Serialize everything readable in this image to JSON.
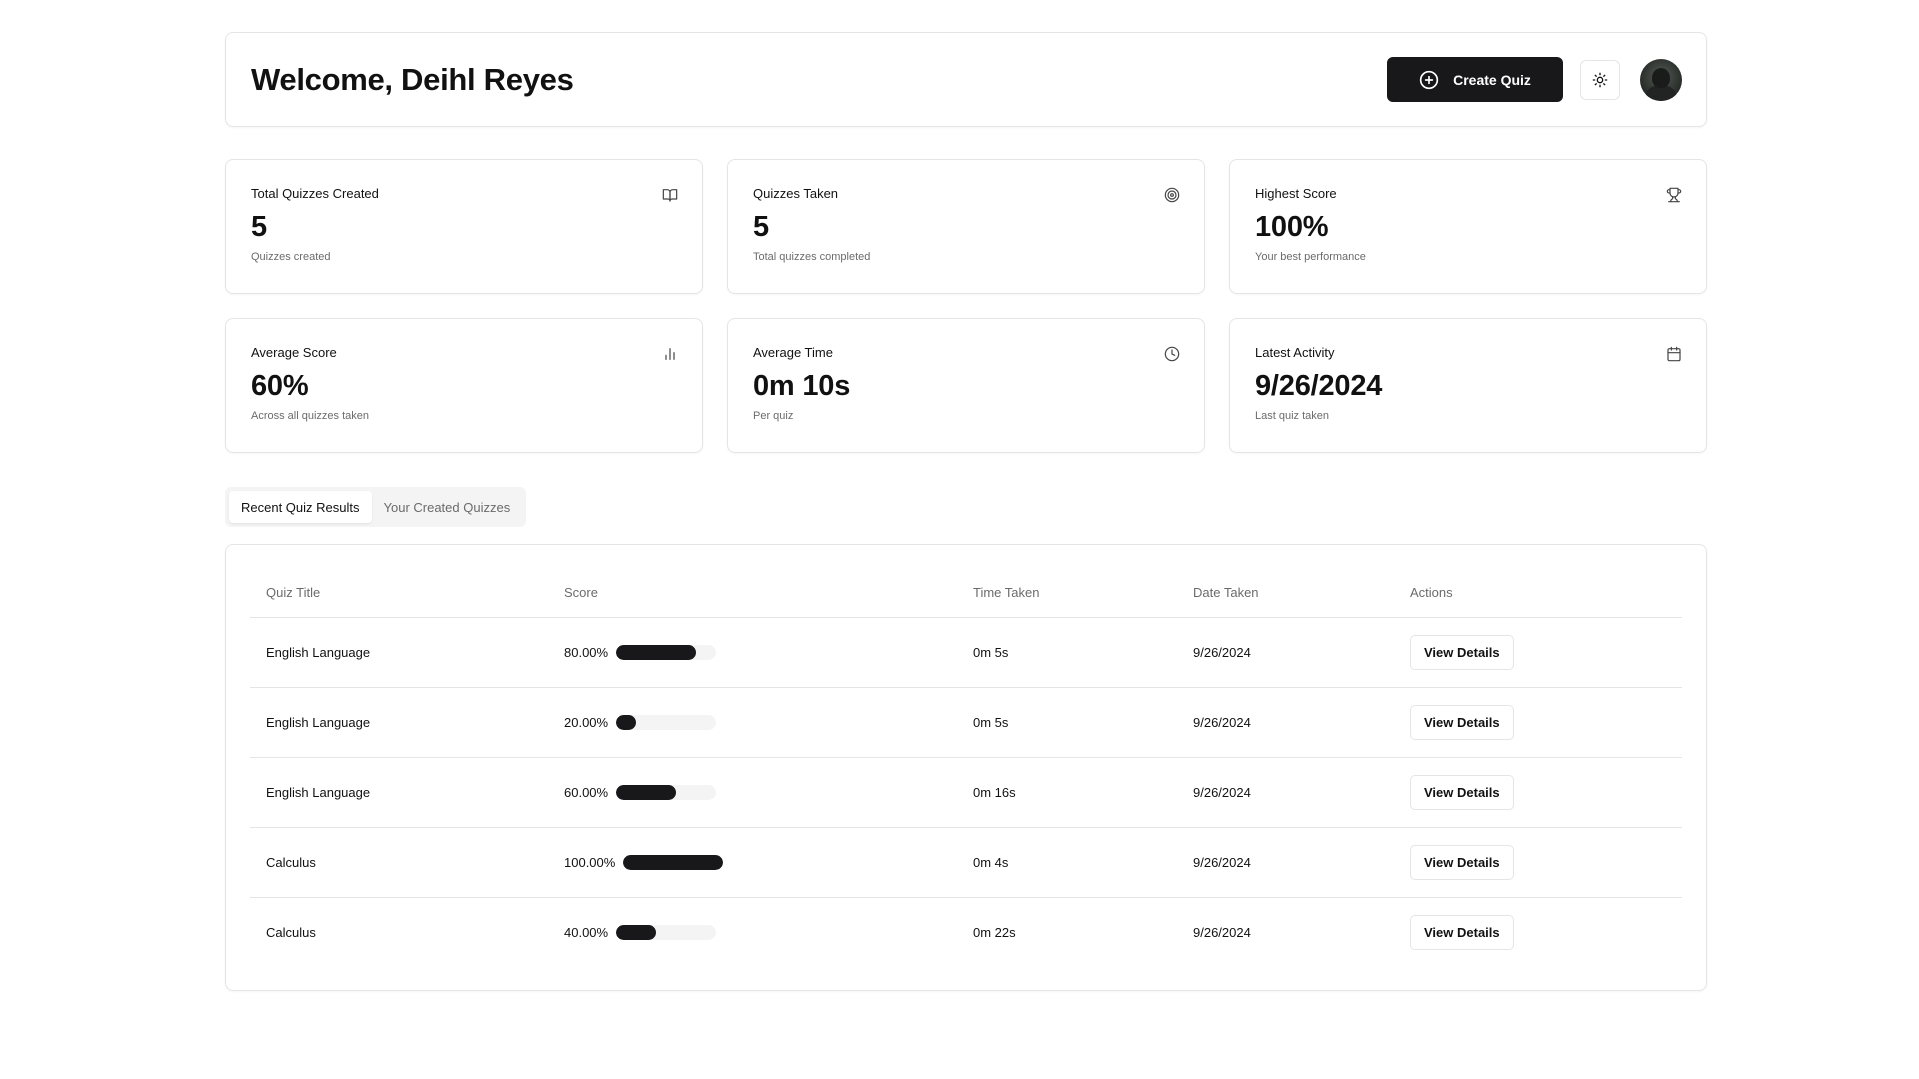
{
  "header": {
    "welcome": "Welcome, Deihl Reyes",
    "create_label": "Create Quiz",
    "create_icon": "plus-circle-icon",
    "theme_icon": "sun-icon"
  },
  "stats": [
    {
      "label": "Total Quizzes Created",
      "value": "5",
      "sub": "Quizzes created",
      "icon": "book-open-icon"
    },
    {
      "label": "Quizzes Taken",
      "value": "5",
      "sub": "Total quizzes completed",
      "icon": "target-icon"
    },
    {
      "label": "Highest Score",
      "value": "100%",
      "sub": "Your best performance",
      "icon": "trophy-icon"
    },
    {
      "label": "Average Score",
      "value": "60%",
      "sub": "Across all quizzes taken",
      "icon": "bar-chart-icon"
    },
    {
      "label": "Average Time",
      "value": "0m 10s",
      "sub": "Per quiz",
      "icon": "clock-icon"
    },
    {
      "label": "Latest Activity",
      "value": "9/26/2024",
      "sub": "Last quiz taken",
      "icon": "calendar-icon"
    }
  ],
  "tabs": [
    {
      "label": "Recent Quiz Results",
      "active": true
    },
    {
      "label": "Your Created Quizzes",
      "active": false
    }
  ],
  "table": {
    "headers": [
      "Quiz Title",
      "Score",
      "Time Taken",
      "Date Taken",
      "Actions"
    ],
    "rows": [
      {
        "title": "English Language",
        "score": "80.00%",
        "fraction": 0.8,
        "time": "0m 5s",
        "date": "9/26/2024",
        "action": "View Details"
      },
      {
        "title": "English Language",
        "score": "20.00%",
        "fraction": 0.2,
        "time": "0m 5s",
        "date": "9/26/2024",
        "action": "View Details"
      },
      {
        "title": "English Language",
        "score": "60.00%",
        "fraction": 0.6,
        "time": "0m 16s",
        "date": "9/26/2024",
        "action": "View Details"
      },
      {
        "title": "Calculus",
        "score": "100.00%",
        "fraction": 1.0,
        "time": "0m 4s",
        "date": "9/26/2024",
        "action": "View Details"
      },
      {
        "title": "Calculus",
        "score": "40.00%",
        "fraction": 0.4,
        "time": "0m 22s",
        "date": "9/26/2024",
        "action": "View Details"
      }
    ]
  },
  "colors": {
    "primary": "#18181b",
    "border": "#e5e5e5",
    "muted_text": "#6b6b6b",
    "track": "#f4f4f5"
  }
}
